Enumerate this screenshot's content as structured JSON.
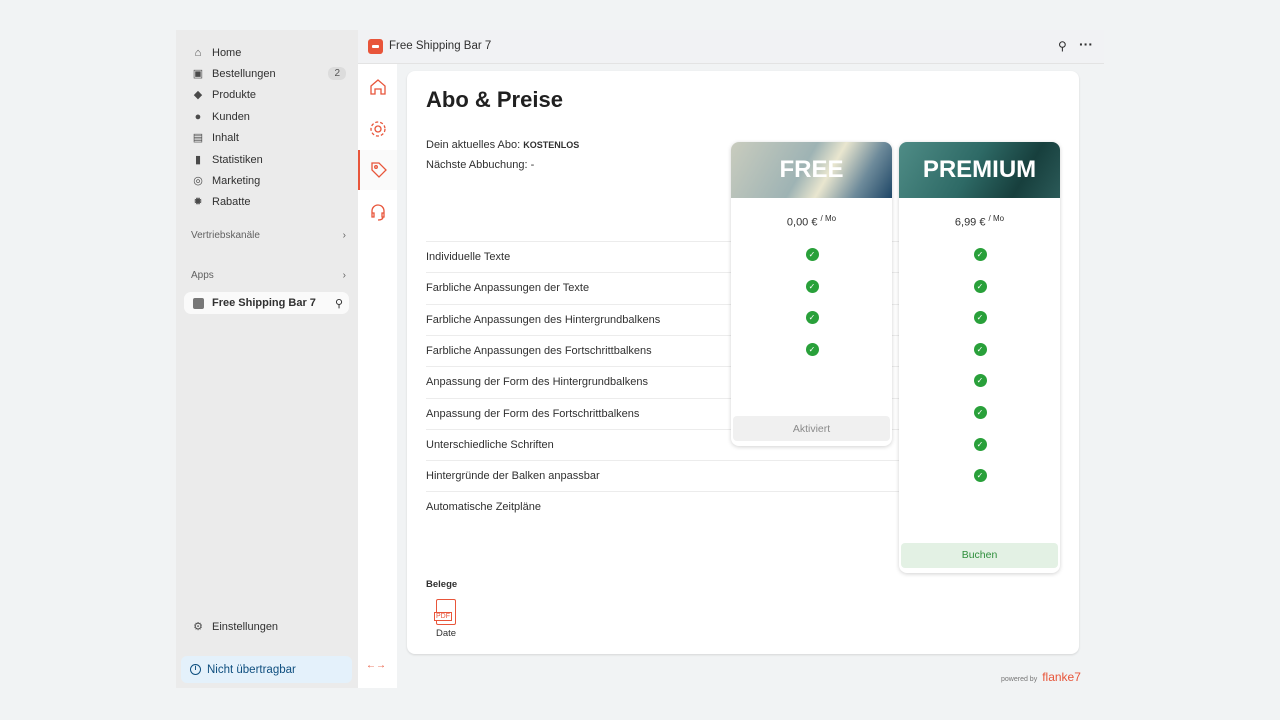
{
  "sidebar": {
    "items": [
      {
        "label": "Home",
        "icon": "home-icon"
      },
      {
        "label": "Bestellungen",
        "icon": "inbox-icon",
        "badge": "2"
      },
      {
        "label": "Produkte",
        "icon": "tag-icon"
      },
      {
        "label": "Kunden",
        "icon": "person-icon"
      },
      {
        "label": "Inhalt",
        "icon": "content-icon"
      },
      {
        "label": "Statistiken",
        "icon": "bar-chart-icon"
      },
      {
        "label": "Marketing",
        "icon": "target-icon"
      },
      {
        "label": "Rabatte",
        "icon": "discount-icon"
      }
    ],
    "sales_channels": "Vertriebskanäle",
    "apps": "Apps",
    "app_item": "Free Shipping Bar 7",
    "settings": "Einstellungen",
    "non_transferable": "Nicht übertragbar"
  },
  "topbar": {
    "title": "Free Shipping Bar 7"
  },
  "page": {
    "title": "Abo & Preise",
    "current_plan_label": "Dein aktuelles Abo:",
    "current_plan": "KOSTENLOS",
    "next_billing": "Nächste Abbuchung: -",
    "features": [
      "Individuelle Texte",
      "Farbliche Anpassungen der Texte",
      "Farbliche Anpassungen des Hintergrundbalkens",
      "Farbliche Anpassungen des Fortschrittbalkens",
      "Anpassung der Form des Hintergrundbalkens",
      "Anpassung der Form des Fortschrittbalkens",
      "Unterschiedliche Schriften",
      "Hintergründe der Balken anpassbar",
      "Automatische Zeitpläne"
    ],
    "plans": [
      {
        "name": "FREE",
        "price": "0,00 €",
        "period": "/ Mo",
        "included": 4,
        "button": "Aktiviert"
      },
      {
        "name": "PREMIUM",
        "price": "6,99 €",
        "period": "/ Mo",
        "included": 8,
        "button": "Buchen"
      }
    ],
    "receipts_title": "Belege",
    "receipt": "Date",
    "pdf": "PDF"
  },
  "footer": {
    "powered": "powered by",
    "brand": "flanke7"
  },
  "colors": {
    "accent": "#e8553a",
    "success": "#29a03a"
  }
}
